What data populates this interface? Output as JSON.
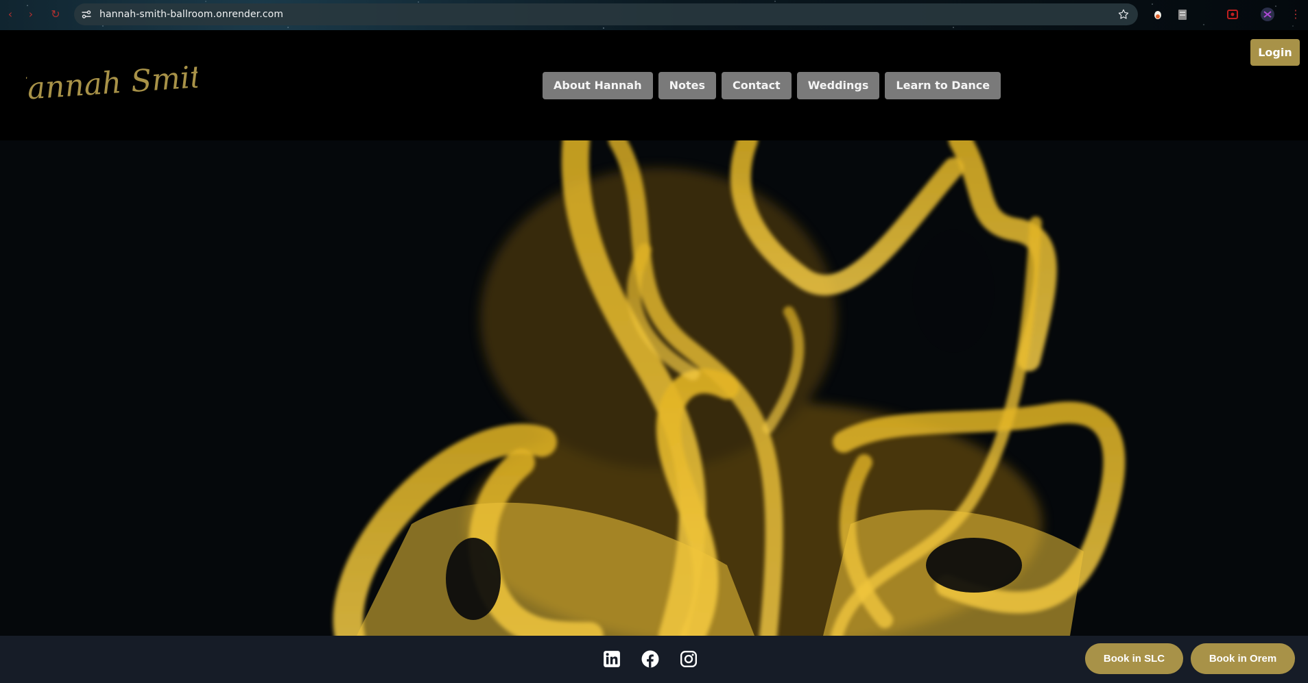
{
  "browser": {
    "url": "hannah-smith-ballroom.onrender.com"
  },
  "header": {
    "logo_text": "·Hannah Smith·",
    "nav": [
      {
        "label": "About Hannah"
      },
      {
        "label": "Notes"
      },
      {
        "label": "Contact"
      },
      {
        "label": "Weddings"
      },
      {
        "label": "Learn to Dance"
      }
    ],
    "login_label": "Login"
  },
  "footer": {
    "social_icons": [
      "linkedin-icon",
      "facebook-icon",
      "instagram-icon"
    ],
    "book_slc_label": "Book in SLC",
    "book_orem_label": "Book in Orem"
  },
  "colors": {
    "accent_gold": "#a89248",
    "nav_button_bg": "#7a7a7a",
    "header_bg": "#000000",
    "footer_bg": "#161c27"
  }
}
